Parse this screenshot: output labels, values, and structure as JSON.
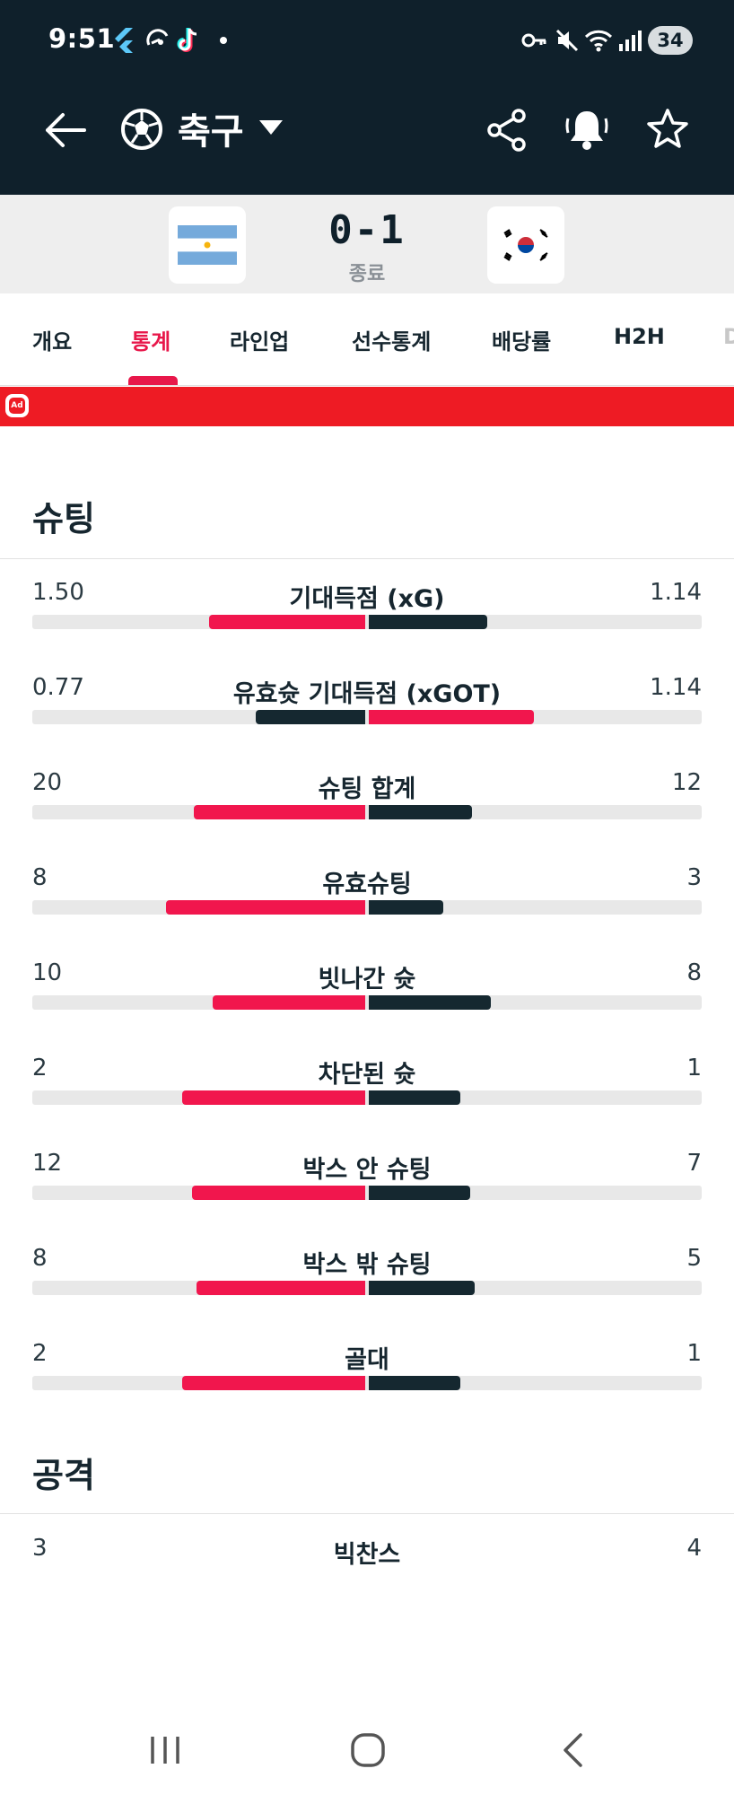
{
  "status_bar": {
    "time": "9:51",
    "battery": "34"
  },
  "app_bar": {
    "sport": "축구"
  },
  "match": {
    "score": "0-1",
    "status": "종료",
    "home_flag": "argentina-flag",
    "away_flag": "south-korea-flag"
  },
  "tabs": [
    {
      "label": "개요"
    },
    {
      "label": "통계"
    },
    {
      "label": "라인업"
    },
    {
      "label": "선수통계"
    },
    {
      "label": "배당률"
    },
    {
      "label": "H2H"
    },
    {
      "label": "D"
    }
  ],
  "active_tab": "통계",
  "colors": {
    "header_bg": "#0f202b",
    "accent": "#e8174a",
    "home_bar": "#f1164d",
    "away_bar": "#152830",
    "ad_bg": "#ee1b24"
  },
  "sections": [
    {
      "title": "슈팅",
      "stats": [
        {
          "label": "기대득점 (xG)",
          "home": "1.50",
          "away": "1.14",
          "home_share": 0.57,
          "away_share": 0.43,
          "leader": "home"
        },
        {
          "label": "유효슛 기대득점 (xGOT)",
          "home": "0.77",
          "away": "1.14",
          "home_share": 0.4,
          "away_share": 0.6,
          "leader": "away"
        },
        {
          "label": "슈팅 합계",
          "home": "20",
          "away": "12",
          "home_share": 0.625,
          "away_share": 0.375,
          "leader": "home"
        },
        {
          "label": "유효슈팅",
          "home": "8",
          "away": "3",
          "home_share": 0.727,
          "away_share": 0.273,
          "leader": "home"
        },
        {
          "label": "빗나간 슛",
          "home": "10",
          "away": "8",
          "home_share": 0.556,
          "away_share": 0.444,
          "leader": "home"
        },
        {
          "label": "차단된 슛",
          "home": "2",
          "away": "1",
          "home_share": 0.667,
          "away_share": 0.333,
          "leader": "home"
        },
        {
          "label": "박스 안 슈팅",
          "home": "12",
          "away": "7",
          "home_share": 0.632,
          "away_share": 0.368,
          "leader": "home"
        },
        {
          "label": "박스 밖 슈팅",
          "home": "8",
          "away": "5",
          "home_share": 0.615,
          "away_share": 0.385,
          "leader": "home"
        },
        {
          "label": "골대",
          "home": "2",
          "away": "1",
          "home_share": 0.667,
          "away_share": 0.333,
          "leader": "home"
        }
      ]
    },
    {
      "title": "공격",
      "stats": [
        {
          "label": "빅찬스",
          "home": "3",
          "away": "4"
        }
      ]
    }
  ]
}
